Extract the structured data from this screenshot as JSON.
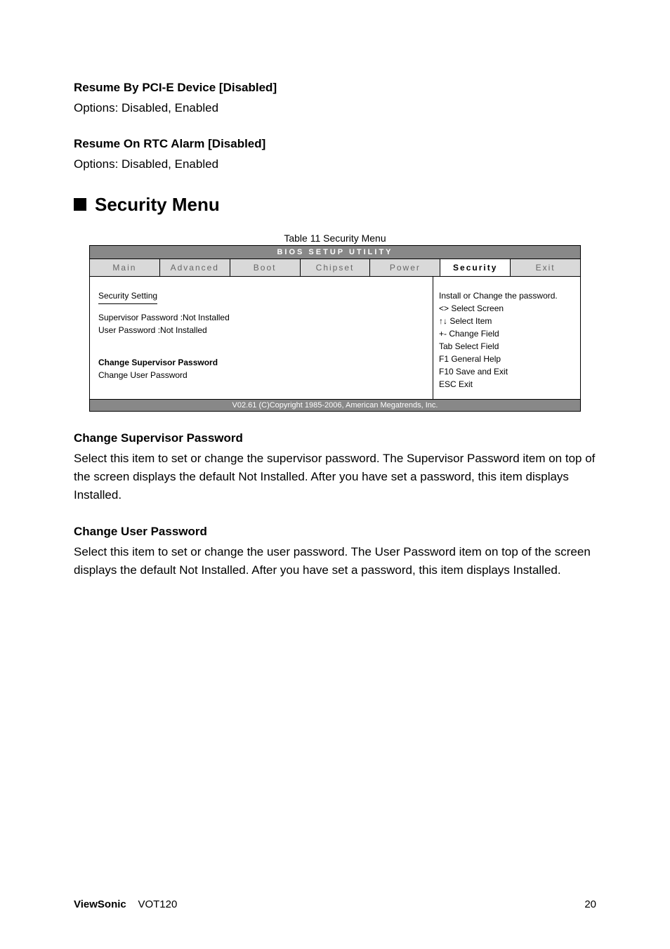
{
  "sec_pci_heading": "Resume By PCI-E Device [Disabled]",
  "sec_pci_body": "Options: Disabled, Enabled",
  "sec_rtc_heading": "Resume On RTC Alarm [Disabled]",
  "sec_rtc_body": "Options: Disabled, Enabled",
  "main_heading": "Security Menu",
  "table_caption": "Table 11 Security Menu",
  "bios": {
    "title": "BIOS SETUP UTILITY",
    "tabs": {
      "main": "Main",
      "advanced": "Advanced",
      "boot": "Boot",
      "chipset": "Chipset",
      "power": "Power",
      "security": "Security",
      "exit": "Exit"
    },
    "left": {
      "heading": "Security Setting",
      "sup_pwd": "Supervisor Password :Not Installed",
      "user_pwd": "User Password :Not Installed",
      "change_sup": "Change Supervisor Password",
      "change_user": "Change User Password"
    },
    "right": {
      "desc": "Install or Change the password.",
      "help1": "<> Select Screen",
      "help2": "↑↓ Select Item",
      "help3": "+- Change Field",
      "help4": "Tab Select Field",
      "help5": "F1 General Help",
      "help6": "F10 Save and Exit",
      "help7": "ESC Exit"
    },
    "footer": "V02.61 (C)Copyright 1985-2006, American Megatrends, Inc."
  },
  "change_sup_heading": "Change Supervisor Password",
  "change_sup_body": "Select this item to set or change the supervisor password. The Supervisor Password item on top of the screen displays the default Not Installed. After you have set a password, this item displays Installed.",
  "change_user_heading": "Change User Password",
  "change_user_body": "Select this item to set or change the user password. The User Password item on top of the screen displays the default Not Installed. After you have set a password, this item displays Installed.",
  "footer_brand": "ViewSonic",
  "footer_model": "VOT120",
  "footer_page": "20"
}
